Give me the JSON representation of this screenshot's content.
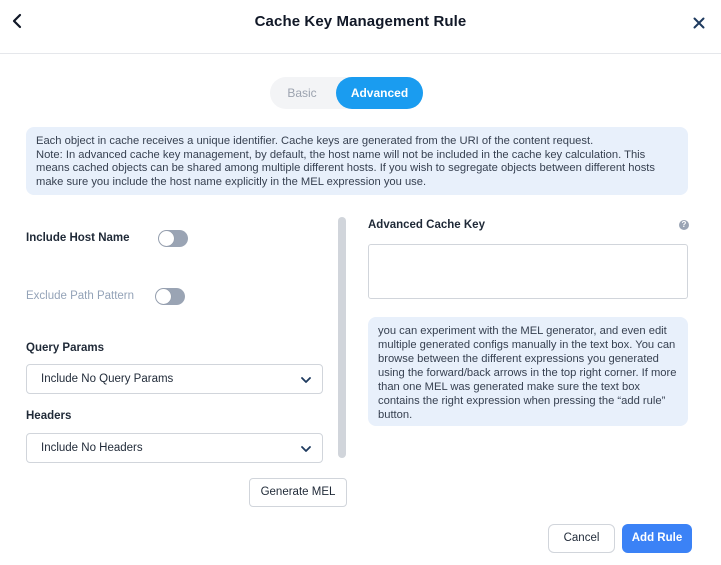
{
  "header": {
    "title": "Cache Key Management Rule",
    "back_icon": "chevron-left-icon",
    "close_icon": "close-icon"
  },
  "mode_tabs": [
    {
      "label": "Basic",
      "selected": false
    },
    {
      "label": "Advanced",
      "selected": true
    }
  ],
  "info": {
    "lines": [
      "Each object in cache receives a unique identifier. Cache keys are generated from the URI of the content request.",
      "Note: In advanced cache key management, by default, the host name will not be included in the cache key calculation. This means cached objects can be shared among multiple different hosts. If you wish to segregate objects between different hosts make sure you include the host name explicitly in the MEL expression you use."
    ]
  },
  "form": {
    "include_host_name": {
      "label": "Include Host Name",
      "enabled": false
    },
    "exclude_path_pattern": {
      "label": "Exclude Path Pattern",
      "enabled": false,
      "disabled": true
    },
    "query_params": {
      "label": "Query Params",
      "value": "Include No Query Params"
    },
    "headers": {
      "label": "Headers",
      "value": "Include No Headers"
    },
    "generate_button": "Generate MEL"
  },
  "advanced": {
    "label": "Advanced Cache Key",
    "help_icon": "question-icon",
    "value": "",
    "hint": "you can experiment with the MEL generator, and even edit multiple generated configs manually in the text box. You can browse between the different expressions you generated using the forward/back arrows in the top right corner. If more than one MEL was generated make sure the text box contains the right expression when pressing the “add rule” button."
  },
  "footer": {
    "cancel": "Cancel",
    "add_rule": "Add Rule"
  },
  "colors": {
    "accent": "#1a9cf0",
    "primary_button": "#3b82f6",
    "info_bg": "#e8f0fb",
    "toggle_off": "#9aa4b4"
  }
}
